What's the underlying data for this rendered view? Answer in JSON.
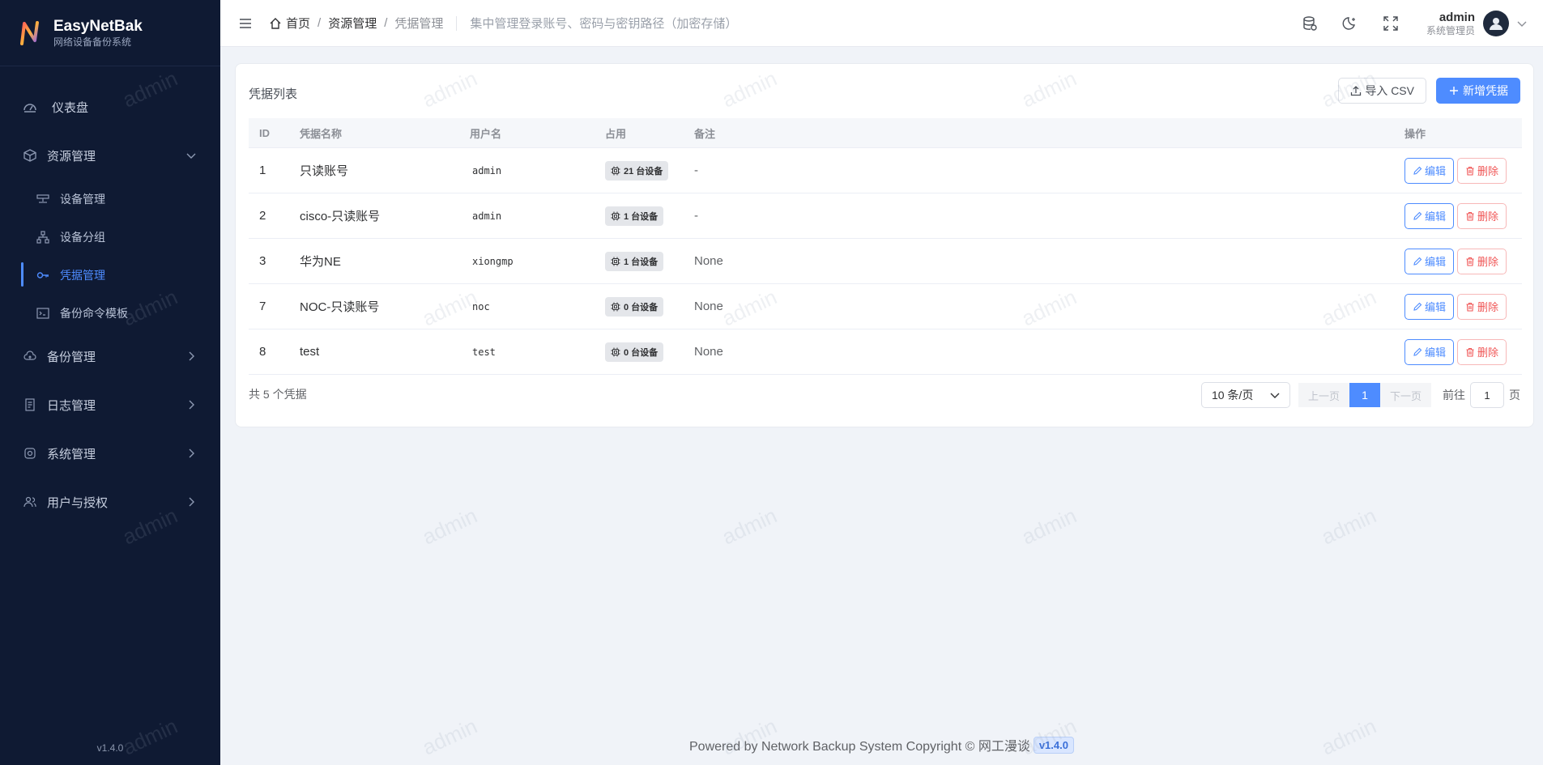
{
  "app": {
    "name": "EasyNetBak",
    "subtitle": "网络设备备份系统",
    "version": "v1.4.0"
  },
  "sidebar": {
    "dashboard": "仪表盘",
    "resource": "资源管理",
    "resource_items": [
      "设备管理",
      "设备分组",
      "凭据管理",
      "备份命令模板"
    ],
    "backup": "备份管理",
    "logs": "日志管理",
    "system": "系统管理",
    "users": "用户与授权"
  },
  "header": {
    "breadcrumb": [
      "首页",
      "资源管理",
      "凭据管理"
    ],
    "sep": "/",
    "description": "集中管理登录账号、密码与密钥路径（加密存储）",
    "user_name": "admin",
    "user_role": "系统管理员"
  },
  "card": {
    "title": "凭据列表",
    "import_label": "导入 CSV",
    "add_label": "新增凭据"
  },
  "table": {
    "columns": {
      "id": "ID",
      "name": "凭据名称",
      "user": "用户名",
      "occupy": "占用",
      "note": "备注",
      "ops": "操作"
    },
    "rows": [
      {
        "id": "1",
        "name": "只读账号",
        "user": "admin",
        "occupy": "21 台设备",
        "note": "-"
      },
      {
        "id": "2",
        "name": "cisco-只读账号",
        "user": "admin",
        "occupy": "1 台设备",
        "note": "-"
      },
      {
        "id": "3",
        "name": "华为NE",
        "user": "xiongmp",
        "occupy": "1 台设备",
        "note": "None"
      },
      {
        "id": "7",
        "name": "NOC-只读账号",
        "user": "noc",
        "occupy": "0 台设备",
        "note": "None"
      },
      {
        "id": "8",
        "name": "test",
        "user": "test",
        "occupy": "0 台设备",
        "note": "None"
      }
    ],
    "edit_label": "编辑",
    "delete_label": "删除"
  },
  "pagination": {
    "total_text": "共 5 个凭据",
    "page_size": "10 条/页",
    "prev": "上一页",
    "next": "下一页",
    "current": "1",
    "goto_prefix": "前往",
    "goto_value": "1",
    "goto_suffix": "页"
  },
  "footer": {
    "text": "Powered by Network Backup System Copyright © 网工漫谈",
    "version": "v1.4.0"
  },
  "watermark": "admin",
  "colors": {
    "primary": "#4e8cff",
    "sidebar_bg": "#0f1a33",
    "danger": "#f05656"
  }
}
